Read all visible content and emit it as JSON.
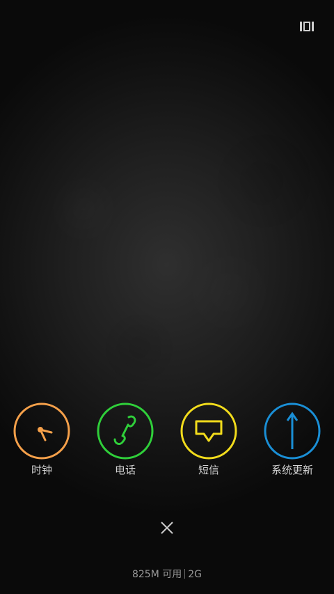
{
  "recent_apps": [
    {
      "label": "时钟",
      "icon": "clock-icon",
      "color": "#f5a04a"
    },
    {
      "label": "电话",
      "icon": "phone-icon",
      "color": "#2fcf3a"
    },
    {
      "label": "短信",
      "icon": "message-icon",
      "color": "#f2dc1c"
    },
    {
      "label": "系统更新",
      "icon": "arrow-up-icon",
      "color": "#1a8fd6"
    }
  ],
  "memory": {
    "available": "825M 可用",
    "total": "2G"
  },
  "controls": {
    "close_icon": "close-icon",
    "multiview_icon": "multi-window-icon"
  }
}
